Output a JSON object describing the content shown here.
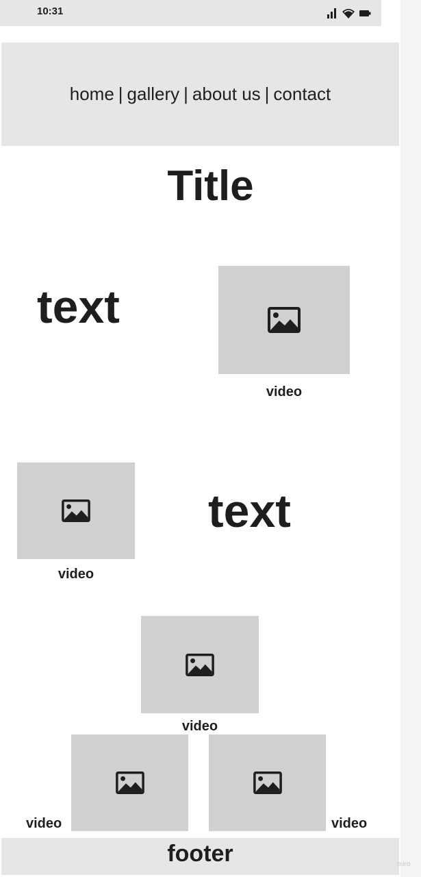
{
  "status_bar": {
    "time": "10:31",
    "icons": [
      "signal-icon",
      "wifi-icon",
      "battery-icon"
    ]
  },
  "nav": {
    "items": [
      {
        "label": "home"
      },
      {
        "label": "gallery"
      },
      {
        "label": "about us"
      },
      {
        "label": "contact"
      }
    ],
    "separator": "|"
  },
  "main": {
    "title": "Title",
    "row1": {
      "text": "text",
      "video_caption": "video"
    },
    "row2": {
      "video_caption": "video",
      "text": "text"
    },
    "center_video": {
      "caption": "video"
    },
    "bottom_videos": [
      {
        "caption": "video"
      },
      {
        "caption": "video"
      }
    ]
  },
  "footer": {
    "label": "footer"
  },
  "watermark": "miro",
  "colors": {
    "panel": "#e6e6e6",
    "placeholder": "#d0d0d0",
    "text": "#1e1e1e"
  }
}
